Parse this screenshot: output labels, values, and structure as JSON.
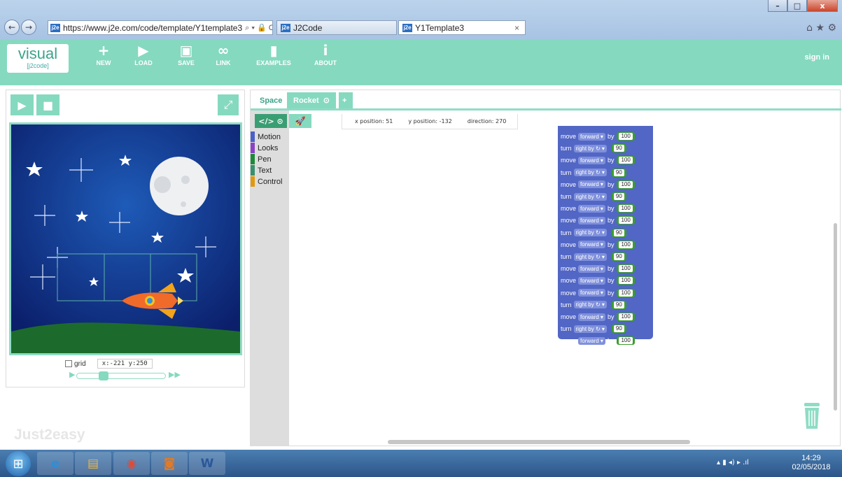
{
  "browser": {
    "address": "https://www.j2e.com/code/template/Y1template3",
    "address_tools": "⌕ ▾ 🔒 C",
    "favicon": "j2e",
    "tabs": [
      {
        "label": "J2Code",
        "favicon": "j2e"
      },
      {
        "label": "Y1Template3",
        "favicon": "j2e"
      }
    ],
    "tab_close": "×",
    "window_controls": {
      "minimize": "–",
      "maximize": "□",
      "close": "x"
    },
    "back_glyph": "←",
    "forward_glyph": "→",
    "icons": "⌂ ★ ⚙"
  },
  "app": {
    "logo_big": "visual",
    "logo_small": "[j2code]",
    "toolbar": [
      {
        "label": "NEW",
        "icon": "+"
      },
      {
        "label": "LOAD",
        "icon": "▶"
      },
      {
        "label": "SAVE",
        "icon": "▣"
      },
      {
        "label": "LINK",
        "icon": "∞"
      },
      {
        "label": "EXAMPLES",
        "icon": "▮"
      },
      {
        "label": "ABOUT",
        "icon": "i"
      }
    ],
    "sign_in": "sign in",
    "accent": "#85d9bf"
  },
  "stage": {
    "play": "▶",
    "stop": "■",
    "fullscreen": "⤢",
    "grid_label": "grid",
    "coords": "x:-221  y:250",
    "speed_level": 0.28,
    "brand": "Just2easy"
  },
  "editor": {
    "tabs": [
      {
        "label": "Space"
      },
      {
        "label": "Rocket"
      }
    ],
    "tab_dropdown": "⊙",
    "add_tab": "+",
    "code_toggle": "</> ⊙",
    "sprite_icon": "🚀",
    "categories": [
      {
        "label": "Motion",
        "color": "#4c5fc7"
      },
      {
        "label": "Looks",
        "color": "#8a43c7"
      },
      {
        "label": "Pen",
        "color": "#1e8a3a"
      },
      {
        "label": "Text",
        "color": "#3a8f6e"
      },
      {
        "label": "Control",
        "color": "#e09a10"
      }
    ],
    "position": {
      "x": "x position: 51",
      "y": "y position: -132",
      "direction": "direction: 270"
    },
    "blocks": [
      {
        "verb": "move",
        "option": "forward ▾",
        "by": "by",
        "value": "100"
      },
      {
        "verb": "turn",
        "option": "right by ↻ ▾",
        "by": "",
        "value": "90"
      },
      {
        "verb": "move",
        "option": "forward ▾",
        "by": "by",
        "value": "100"
      },
      {
        "verb": "turn",
        "option": "right by ↻ ▾",
        "by": "",
        "value": "90"
      },
      {
        "verb": "move",
        "option": "forward ▾",
        "by": "by",
        "value": "100"
      },
      {
        "verb": "turn",
        "option": "right by ↻ ▾",
        "by": "",
        "value": "90"
      },
      {
        "verb": "move",
        "option": "forward ▾",
        "by": "by",
        "value": "100"
      },
      {
        "verb": "move",
        "option": "forward ▾",
        "by": "by",
        "value": "100"
      },
      {
        "verb": "turn",
        "option": "right by ↻ ▾",
        "by": "",
        "value": "90"
      },
      {
        "verb": "move",
        "option": "forward ▾",
        "by": "by",
        "value": "100"
      },
      {
        "verb": "turn",
        "option": "right by ↻ ▾",
        "by": "",
        "value": "90"
      },
      {
        "verb": "move",
        "option": "forward ▾",
        "by": "by",
        "value": "100"
      },
      {
        "verb": "move",
        "option": "forward ▾",
        "by": "by",
        "value": "100"
      },
      {
        "verb": "move",
        "option": "forward ▾",
        "by": "by",
        "value": "100"
      },
      {
        "verb": "turn",
        "option": "right by ↻ ▾",
        "by": "",
        "value": "90"
      },
      {
        "verb": "move",
        "option": "forward ▾",
        "by": "by",
        "value": "100"
      },
      {
        "verb": "turn",
        "option": "right by ↻ ▾",
        "by": "",
        "value": "90"
      },
      {
        "verb": "move",
        "option": "forward ▾",
        "by": "by",
        "value": "100"
      }
    ]
  },
  "taskbar": {
    "start": "⊞",
    "apps": [
      {
        "icon": "e",
        "color": "#2a8fdc"
      },
      {
        "icon": "▤",
        "color": "#e8b64c"
      },
      {
        "icon": "◉",
        "color": "#dd4b39"
      },
      {
        "icon": "◙",
        "color": "#e07a28"
      },
      {
        "icon": "W",
        "color": "#2b579a"
      }
    ],
    "tray": "▴  ▮  ◂)  ▸  .ıl",
    "time": "14:29",
    "date": "02/05/2018"
  }
}
